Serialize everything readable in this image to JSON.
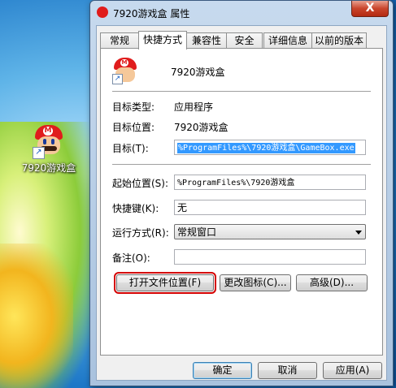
{
  "desktop": {
    "icon_label": "7920游戏盒"
  },
  "window": {
    "title": "7920游戏盒 属性",
    "close_glyph": "X"
  },
  "tabs": [
    {
      "label": "常规"
    },
    {
      "label": "快捷方式",
      "active": true
    },
    {
      "label": "兼容性"
    },
    {
      "label": "安全"
    },
    {
      "label": "详细信息"
    },
    {
      "label": "以前的版本"
    }
  ],
  "shortcut": {
    "name": "7920游戏盒",
    "target_type_label": "目标类型:",
    "target_type_value": "应用程序",
    "target_location_label": "目标位置:",
    "target_location_value": "7920游戏盒",
    "target_label": "目标(T):",
    "target_value": "%ProgramFiles%\\7920游戏盒\\GameBox.exe",
    "start_in_label": "起始位置(S):",
    "start_in_value": "%ProgramFiles%\\7920游戏盒",
    "hotkey_label": "快捷键(K):",
    "hotkey_value": "无",
    "run_label": "运行方式(R):",
    "run_value": "常规窗口",
    "comment_label": "备注(O):",
    "comment_value": ""
  },
  "buttons": {
    "open_location": "打开文件位置(F)",
    "change_icon": "更改图标(C)...",
    "advanced": "高级(D)...",
    "ok": "确定",
    "cancel": "取消",
    "apply": "应用(A)"
  }
}
